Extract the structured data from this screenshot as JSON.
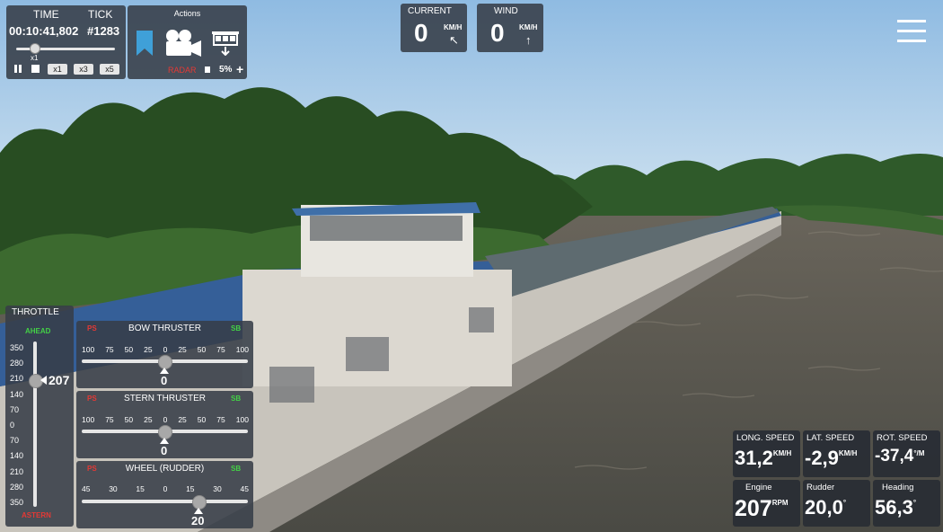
{
  "hud": {
    "time_label": "TIME",
    "tick_label": "TICK",
    "time_value": "00:10:41,802",
    "tick_value": "#1283",
    "speed_indicator": "x1",
    "speed_buttons": [
      "x1",
      "x3",
      "x5"
    ],
    "actions_label": "Actions",
    "radar_label": "RADAR",
    "volume_label": "5%"
  },
  "current": {
    "label": "CURRENT",
    "value": "0",
    "unit": "KM/H",
    "arrow": "↖"
  },
  "wind": {
    "label": "WIND",
    "value": "0",
    "unit": "KM/H",
    "arrow": "↑"
  },
  "throttle": {
    "title": "THROTTLE",
    "ahead": "AHEAD",
    "astern": "ASTERN",
    "ticks": [
      "350",
      "280",
      "210",
      "140",
      "70",
      "0",
      "70",
      "140",
      "210",
      "280",
      "350"
    ],
    "value": "207"
  },
  "bow_thruster": {
    "title": "BOW THRUSTER",
    "ps": "PS",
    "sb": "SB",
    "scale": [
      "100",
      "75",
      "50",
      "25",
      "0",
      "25",
      "50",
      "75",
      "100"
    ],
    "value": "0"
  },
  "stern_thruster": {
    "title": "STERN THRUSTER",
    "ps": "PS",
    "sb": "SB",
    "scale": [
      "100",
      "75",
      "50",
      "25",
      "0",
      "25",
      "50",
      "75",
      "100"
    ],
    "value": "0"
  },
  "rudder": {
    "title": "WHEEL (RUDDER)",
    "ps": "PS",
    "sb": "SB",
    "scale": [
      "45",
      "30",
      "15",
      "0",
      "15",
      "30",
      "45"
    ],
    "value": "20"
  },
  "gauges": {
    "long_speed": {
      "label": "LONG. SPEED",
      "value": "31,2",
      "unit": "KM/H"
    },
    "lat_speed": {
      "label": "LAT. SPEED",
      "value": "-2,9",
      "unit": "KM/H"
    },
    "rot_speed": {
      "label": "ROT. SPEED",
      "value": "-37,4",
      "unit": "°/M"
    },
    "engine": {
      "label": "Engine",
      "value": "207",
      "unit": "RPM"
    },
    "rudder": {
      "label": "Rudder",
      "value": "20,0",
      "unit": "°"
    },
    "heading": {
      "label": "Heading",
      "value": "56,3",
      "unit": "°"
    }
  },
  "colors": {
    "ps": "#e53935",
    "sb": "#43d046",
    "bookmark": "#3fa0d8"
  }
}
